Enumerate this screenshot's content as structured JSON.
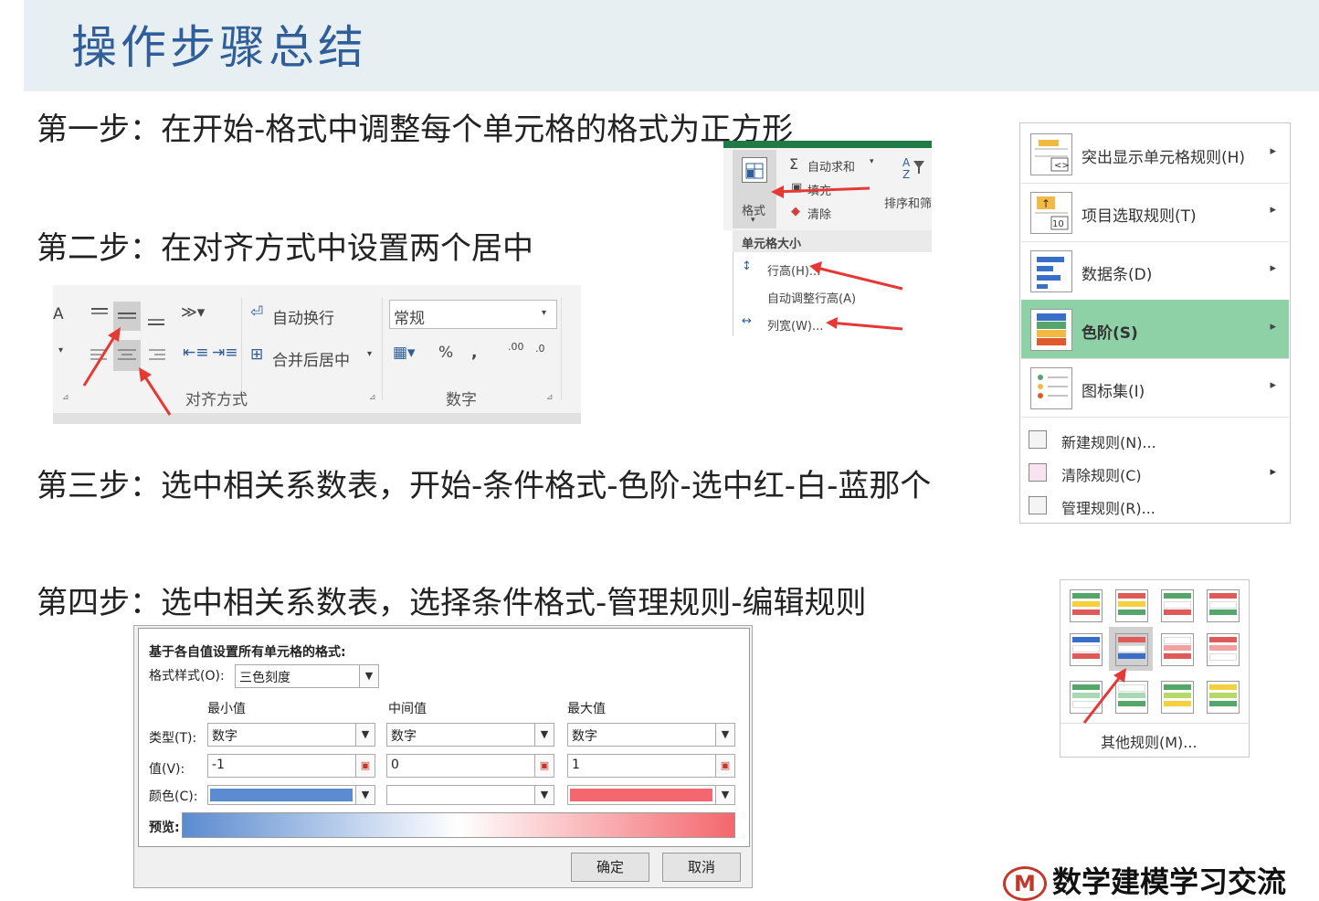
{
  "title": "操作步骤总结",
  "steps": {
    "s1": "第一步：在开始-格式中调整每个单元格的格式为正方形",
    "s2": "第二步：在对齐方式中设置两个居中",
    "s3": "第三步：选中相关系数表，开始-条件格式-色阶-选中红-白-蓝那个",
    "s4": "第四步：选中相关系数表，选择条件格式-管理规则-编辑规则"
  },
  "format_ribbon": {
    "format_label": "格式",
    "autosum": "自动求和",
    "fill": "填充",
    "clear": "清除",
    "sort_filter": "排序和筛",
    "menu_header": "单元格大小",
    "row_height": "行高(H)...",
    "autofit_row": "自动调整行高(A)",
    "col_width": "列宽(W)..."
  },
  "align_ribbon": {
    "wrap_text": "自动换行",
    "merge_center": "合并后居中",
    "number_format": "常规",
    "group_align": "对齐方式",
    "group_number": "数字",
    "percent": "%",
    "comma": ",",
    "inc_decimal": ".00",
    "dec_decimal": ".0",
    "side_letter": "A"
  },
  "cf_menu": {
    "items": [
      {
        "label": "突出显示单元格规则(H)"
      },
      {
        "label": "项目选取规则(T)"
      },
      {
        "label": "数据条(D)"
      },
      {
        "label": "色阶(S)"
      },
      {
        "label": "图标集(I)"
      }
    ],
    "sub": [
      {
        "label": "新建规则(N)..."
      },
      {
        "label": "清除规则(C)"
      },
      {
        "label": "管理规则(R)..."
      }
    ],
    "icon_text_10": "10"
  },
  "color_scale_grid": {
    "more_rules": "其他规则(M)..."
  },
  "dialog": {
    "heading": "基于各自值设置所有单元格的格式:",
    "style_label": "格式样式(O):",
    "style_value": "三色刻度",
    "min_header": "最小值",
    "mid_header": "中间值",
    "max_header": "最大值",
    "type_label": "类型(T):",
    "value_label": "值(V):",
    "color_label": "颜色(C):",
    "preview_label": "预览:",
    "type_min": "数字",
    "type_mid": "数字",
    "type_max": "数字",
    "val_min": "-1",
    "val_mid": "0",
    "val_max": "1",
    "ok": "确定",
    "cancel": "取消",
    "colors": {
      "min": "#5b8bd0",
      "mid": "#ffffff",
      "max": "#f4676e"
    }
  },
  "logo": {
    "mark": "M",
    "text": "数学建模学习交流"
  }
}
